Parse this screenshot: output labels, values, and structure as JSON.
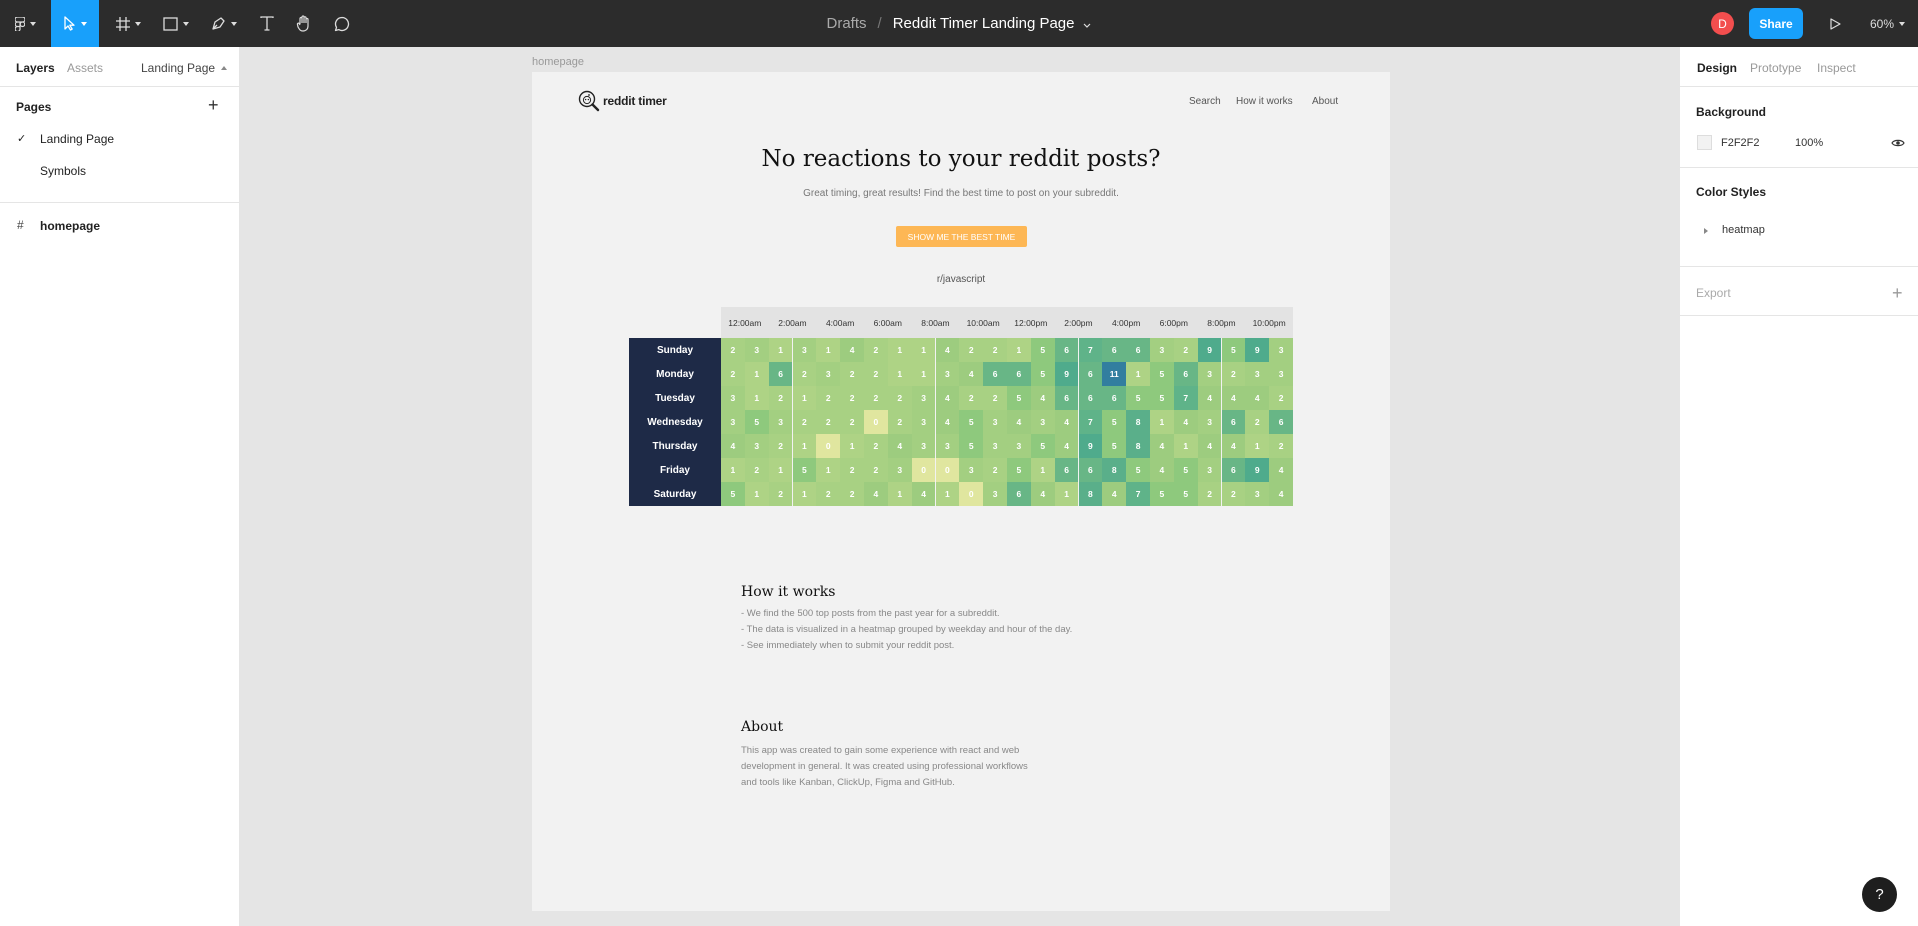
{
  "toolbar": {
    "tools": [
      {
        "name": "main-menu",
        "icon": "figma-logo-icon"
      },
      {
        "name": "move-tool",
        "icon": "cursor-icon"
      },
      {
        "name": "frame-tool",
        "icon": "hash-frame-icon"
      },
      {
        "name": "shape-tool",
        "icon": "rectangle-icon"
      },
      {
        "name": "pen-tool",
        "icon": "pen-icon"
      },
      {
        "name": "text-tool",
        "icon": "text-icon"
      },
      {
        "name": "hand-tool",
        "icon": "hand-icon"
      },
      {
        "name": "comment-tool",
        "icon": "comment-icon"
      }
    ],
    "breadcrumb_folder": "Drafts",
    "breadcrumb_sep": "/",
    "file_name": "Reddit Timer Landing Page",
    "avatar_initial": "D",
    "share_label": "Share",
    "zoom": "60%"
  },
  "left_panel": {
    "tabs": [
      "Layers",
      "Assets"
    ],
    "current_page": "Landing Page",
    "pages_header": "Pages",
    "pages": [
      {
        "label": "Landing Page",
        "checked": "✓"
      },
      {
        "label": "Symbols",
        "checked": ""
      }
    ],
    "layers": [
      {
        "label": "homepage",
        "icon": "#"
      }
    ]
  },
  "right_panel": {
    "tabs": [
      "Design",
      "Prototype",
      "Inspect"
    ],
    "background_title": "Background",
    "bg_color_hex": "F2F2F2",
    "bg_opacity": "100%",
    "color_styles_title": "Color Styles",
    "color_style_item": "heatmap",
    "export_title": "Export"
  },
  "canvas": {
    "frame_label": "homepage",
    "logo_text": "reddit timer",
    "nav": [
      "Search",
      "How it works",
      "About"
    ],
    "hero_title": "No reactions to your reddit posts?",
    "hero_sub": "Great timing, great results! Find the best time to post on your subreddit.",
    "cta": "SHOW ME THE BEST TIME",
    "subreddit": "r/javascript",
    "heatmap": {
      "hours": [
        "12:00am",
        "2:00am",
        "4:00am",
        "6:00am",
        "8:00am",
        "10:00am",
        "12:00pm",
        "2:00pm",
        "4:00pm",
        "6:00pm",
        "8:00pm",
        "10:00pm"
      ],
      "days": [
        "Sunday",
        "Monday",
        "Tuesday",
        "Wednesday",
        "Thursday",
        "Friday",
        "Saturday"
      ],
      "values": [
        [
          2,
          3,
          1,
          3,
          1,
          4,
          2,
          1,
          1,
          4,
          2,
          2,
          1,
          5,
          6,
          7,
          6,
          6,
          3,
          2,
          9,
          5,
          9,
          3
        ],
        [
          2,
          1,
          6,
          2,
          3,
          2,
          2,
          1,
          1,
          3,
          4,
          6,
          6,
          5,
          9,
          6,
          11,
          1,
          5,
          6,
          3,
          2,
          3,
          3
        ],
        [
          3,
          1,
          2,
          1,
          2,
          2,
          2,
          2,
          3,
          4,
          2,
          2,
          5,
          4,
          6,
          6,
          6,
          5,
          5,
          7,
          4,
          4,
          4,
          2
        ],
        [
          3,
          5,
          3,
          2,
          2,
          2,
          0,
          2,
          3,
          4,
          5,
          3,
          4,
          3,
          4,
          7,
          5,
          8,
          1,
          4,
          3,
          6,
          2,
          6
        ],
        [
          4,
          3,
          2,
          1,
          0,
          1,
          2,
          4,
          3,
          3,
          5,
          3,
          3,
          5,
          4,
          9,
          5,
          8,
          4,
          1,
          4,
          4,
          1,
          2
        ],
        [
          1,
          2,
          1,
          5,
          1,
          2,
          2,
          3,
          0,
          0,
          3,
          2,
          5,
          1,
          6,
          6,
          8,
          5,
          4,
          5,
          3,
          6,
          9,
          4
        ],
        [
          5,
          1,
          2,
          1,
          2,
          2,
          4,
          1,
          4,
          1,
          0,
          3,
          6,
          4,
          1,
          8,
          4,
          7,
          5,
          5,
          2,
          2,
          3,
          4
        ]
      ],
      "colors": {
        "0": "#e0e69f",
        "1": "#aed385",
        "2": "#a8d183",
        "3": "#a3cf81",
        "4": "#9dcc7f",
        "5": "#8ec97d",
        "6": "#68b686",
        "7": "#5fb389",
        "8": "#5aaf8a",
        "9": "#4fab8c",
        "10": "#3a9393",
        "11": "#327e9f"
      }
    },
    "how_title": "How it works",
    "how_lines": [
      "- We find the 500 top posts from the past year for a subreddit.",
      "- The data is visualized in a heatmap grouped by weekday and hour of the day.",
      "- See immediately when to submit your reddit post."
    ],
    "about_title": "About",
    "about_lines": [
      "This app was created to gain some experience with react and web",
      "development in general. It was created using professional workflows",
      "and tools like Kanban, ClickUp, Figma and GitHub."
    ]
  },
  "help_label": "?"
}
